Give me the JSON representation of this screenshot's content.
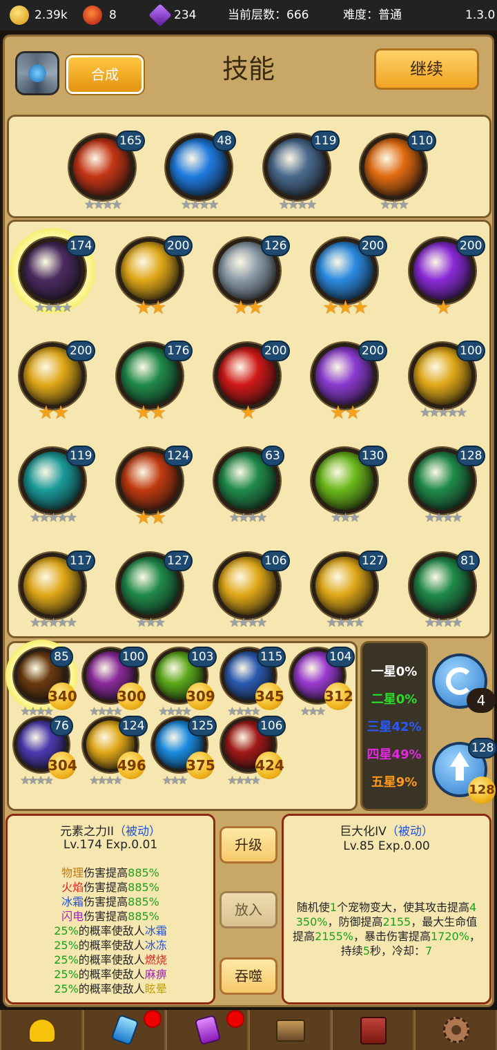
{
  "topbar": {
    "gold": "2.39k",
    "fire": "8",
    "gem": "234",
    "floor_label": "当前层数：666",
    "difficulty_label": "难度：普通",
    "version": "1.3.0"
  },
  "header": {
    "title": "技能",
    "synth_btn": "合成",
    "continue_btn": "继续"
  },
  "equipped": [
    {
      "name": "lava-skill",
      "level": "165",
      "stars": 4,
      "gold": false,
      "color": "#c53516"
    },
    {
      "name": "ice-burst-skill",
      "level": "48",
      "stars": 4,
      "gold": false,
      "color": "#1f7be0"
    },
    {
      "name": "rock-skill",
      "level": "119",
      "stars": 4,
      "gold": false,
      "color": "#4a6a8e"
    },
    {
      "name": "holy-cross-skill",
      "level": "110",
      "stars": 3,
      "gold": false,
      "color": "#e06a10"
    }
  ],
  "grid": [
    {
      "name": "dark-element-skill",
      "level": "174",
      "stars": 4,
      "gold": false,
      "color": "#4a2a60",
      "selected": true
    },
    {
      "name": "gold-scroll-skill",
      "level": "200",
      "stars": 2,
      "gold": true,
      "color": "#e0a818"
    },
    {
      "name": "rock-skill",
      "level": "126",
      "stars": 2,
      "gold": true,
      "color": "#8a9aa8"
    },
    {
      "name": "frost-skill",
      "level": "200",
      "stars": 3,
      "gold": true,
      "color": "#2a8ae0"
    },
    {
      "name": "lightning-skill",
      "level": "200",
      "stars": 1,
      "gold": true,
      "color": "#8a2ad8"
    },
    {
      "name": "gold-scroll-skill",
      "level": "200",
      "stars": 2,
      "gold": true,
      "color": "#e0a818"
    },
    {
      "name": "shadow-skill",
      "level": "176",
      "stars": 2,
      "gold": true,
      "color": "#1f8a4a"
    },
    {
      "name": "blood-skill",
      "level": "200",
      "stars": 1,
      "gold": true,
      "color": "#d01818"
    },
    {
      "name": "void-skill",
      "level": "200",
      "stars": 2,
      "gold": true,
      "color": "#8a3ad0"
    },
    {
      "name": "gold-scroll-skill",
      "level": "100",
      "stars": 5,
      "gold": false,
      "color": "#e0a818"
    },
    {
      "name": "wind-skill",
      "level": "119",
      "stars": 5,
      "gold": false,
      "color": "#1a9a9a"
    },
    {
      "name": "berserk-skill",
      "level": "124",
      "stars": 2,
      "gold": true,
      "color": "#c03a10"
    },
    {
      "name": "shadow-skill",
      "level": "63",
      "stars": 4,
      "gold": false,
      "color": "#1f8a4a"
    },
    {
      "name": "nature-skill",
      "level": "130",
      "stars": 3,
      "gold": false,
      "color": "#6ab81a"
    },
    {
      "name": "shadow-skill",
      "level": "128",
      "stars": 4,
      "gold": false,
      "color": "#1f8a4a"
    },
    {
      "name": "gold-scroll-skill",
      "level": "117",
      "stars": 5,
      "gold": false,
      "color": "#e0a818"
    },
    {
      "name": "shadow-skill",
      "level": "127",
      "stars": 3,
      "gold": false,
      "color": "#1f8a4a"
    },
    {
      "name": "gold-scroll-skill",
      "level": "106",
      "stars": 4,
      "gold": false,
      "color": "#e0a818"
    },
    {
      "name": "gold-scroll-skill",
      "level": "127",
      "stars": 4,
      "gold": false,
      "color": "#e0a818"
    },
    {
      "name": "shadow-skill",
      "level": "81",
      "stars": 4,
      "gold": false,
      "color": "#1f8a4a"
    }
  ],
  "inventory": [
    {
      "name": "giant-skill",
      "level": "85",
      "count": "340",
      "stars": 4,
      "color": "#6a3a10",
      "selected": true
    },
    {
      "name": "void-orb-skill",
      "level": "100",
      "count": "300",
      "stars": 4,
      "color": "#8a2a9a"
    },
    {
      "name": "nature-burst-skill",
      "level": "103",
      "count": "309",
      "stars": 4,
      "color": "#5aa81a"
    },
    {
      "name": "ice-shard-skill",
      "level": "115",
      "count": "345",
      "stars": 4,
      "color": "#2a5ab0"
    },
    {
      "name": "star-skill",
      "level": "104",
      "count": "312",
      "stars": 3,
      "color": "#9a3ad0"
    },
    {
      "name": "spirit-skill",
      "level": "76",
      "count": "304",
      "stars": 4,
      "color": "#4a3ab0"
    },
    {
      "name": "gold-scroll-skill",
      "level": "124",
      "count": "496",
      "stars": 4,
      "color": "#e0a818"
    },
    {
      "name": "light-burst-skill",
      "level": "125",
      "count": "375",
      "stars": 3,
      "color": "#1a8ae0"
    },
    {
      "name": "crimson-skill",
      "level": "106",
      "count": "424",
      "stars": 4,
      "color": "#a01818"
    }
  ],
  "odds": [
    {
      "label": "一星0%",
      "color": "#ffffff"
    },
    {
      "label": "二星0%",
      "color": "#2adc2a"
    },
    {
      "label": "三星42%",
      "color": "#2a5aff"
    },
    {
      "label": "四星49%",
      "color": "#e02ae0"
    },
    {
      "label": "五星9%",
      "color": "#ff9a1a"
    }
  ],
  "refresh": {
    "count": "4"
  },
  "upgrade": {
    "level": "128",
    "count": "128"
  },
  "left_info": {
    "title": "元素之力II",
    "tag": "（被动）",
    "sub": "Lv.174 Exp.0.01",
    "lines": [
      [
        {
          "t": "物理",
          "c": "#c07a10"
        },
        {
          "t": "伤害提高",
          "c": "#222"
        },
        {
          "t": "885%",
          "c": "#1aa01a"
        }
      ],
      [
        {
          "t": "火焰",
          "c": "#e02020"
        },
        {
          "t": "伤害提高",
          "c": "#222"
        },
        {
          "t": "885%",
          "c": "#1aa01a"
        }
      ],
      [
        {
          "t": "冰霜",
          "c": "#2050e0"
        },
        {
          "t": "伤害提高",
          "c": "#222"
        },
        {
          "t": "885%",
          "c": "#1aa01a"
        }
      ],
      [
        {
          "t": "闪电",
          "c": "#a020c0"
        },
        {
          "t": "伤害提高",
          "c": "#222"
        },
        {
          "t": "885%",
          "c": "#1aa01a"
        }
      ],
      [
        {
          "t": "25%",
          "c": "#1aa01a"
        },
        {
          "t": "的概率使敌人",
          "c": "#222"
        },
        {
          "t": "冰霜",
          "c": "#2050e0"
        }
      ],
      [
        {
          "t": "25%",
          "c": "#1aa01a"
        },
        {
          "t": "的概率使敌人",
          "c": "#222"
        },
        {
          "t": "冰冻",
          "c": "#2050e0"
        }
      ],
      [
        {
          "t": "25%",
          "c": "#1aa01a"
        },
        {
          "t": "的概率使敌人",
          "c": "#222"
        },
        {
          "t": "燃烧",
          "c": "#e02020"
        }
      ],
      [
        {
          "t": "25%",
          "c": "#1aa01a"
        },
        {
          "t": "的概率使敌人",
          "c": "#222"
        },
        {
          "t": "麻痹",
          "c": "#a020c0"
        }
      ],
      [
        {
          "t": "25%",
          "c": "#1aa01a"
        },
        {
          "t": "的概率使敌人",
          "c": "#222"
        },
        {
          "t": "眩晕",
          "c": "#c0a010"
        }
      ]
    ]
  },
  "actions": {
    "upgrade": "升级",
    "place": "放入",
    "devour": "吞噬"
  },
  "right_info": {
    "title": "巨大化IV",
    "tag": "（被动）",
    "sub": "Lv.85 Exp.0.00",
    "lines": [
      [
        {
          "t": "随机使",
          "c": "#222"
        },
        {
          "t": "1",
          "c": "#1aa01a"
        },
        {
          "t": "个宠物变大，使其攻击提高",
          "c": "#222"
        },
        {
          "t": "4",
          "c": "#1aa01a"
        }
      ],
      [
        {
          "t": "350%",
          "c": "#1aa01a"
        },
        {
          "t": "，防御提高",
          "c": "#222"
        },
        {
          "t": "2155",
          "c": "#1aa01a"
        },
        {
          "t": "，最大生命值",
          "c": "#222"
        }
      ],
      [
        {
          "t": "提高",
          "c": "#222"
        },
        {
          "t": "2155%",
          "c": "#1aa01a"
        },
        {
          "t": "，暴击伤害提高",
          "c": "#222"
        },
        {
          "t": "1720%",
          "c": "#1aa01a"
        },
        {
          "t": "，",
          "c": "#222"
        }
      ],
      [
        {
          "t": "持续",
          "c": "#222"
        },
        {
          "t": "5",
          "c": "#1aa01a"
        },
        {
          "t": "秒，冷却：",
          "c": "#222"
        },
        {
          "t": "7",
          "c": "#1aa01a"
        }
      ]
    ]
  },
  "nav": [
    {
      "name": "hero-tab",
      "icon": "person-icon",
      "badge": false
    },
    {
      "name": "crystal-tab",
      "icon": "crystal-icon",
      "badge": true
    },
    {
      "name": "gem-tab",
      "icon": "purple-gem-icon",
      "badge": true
    },
    {
      "name": "forge-tab",
      "icon": "anvil-icon",
      "badge": false
    },
    {
      "name": "book-tab",
      "icon": "book-icon",
      "badge": false
    },
    {
      "name": "settings-tab",
      "icon": "gear-icon",
      "badge": false
    }
  ]
}
